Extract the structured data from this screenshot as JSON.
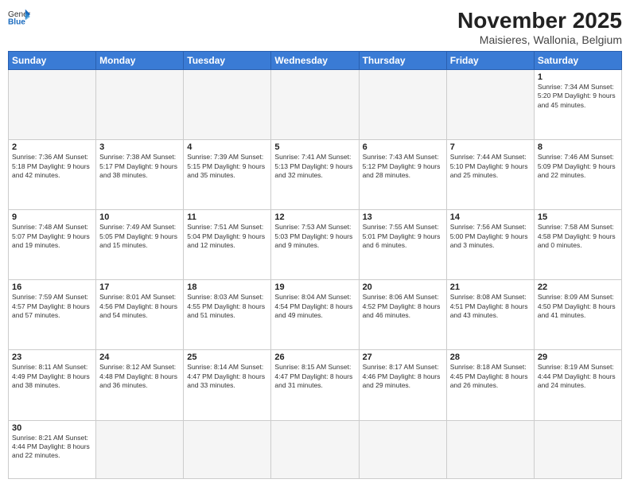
{
  "header": {
    "logo_general": "General",
    "logo_blue": "Blue",
    "month": "November 2025",
    "location": "Maisieres, Wallonia, Belgium"
  },
  "weekdays": [
    "Sunday",
    "Monday",
    "Tuesday",
    "Wednesday",
    "Thursday",
    "Friday",
    "Saturday"
  ],
  "weeks": [
    [
      {
        "day": "",
        "info": ""
      },
      {
        "day": "",
        "info": ""
      },
      {
        "day": "",
        "info": ""
      },
      {
        "day": "",
        "info": ""
      },
      {
        "day": "",
        "info": ""
      },
      {
        "day": "",
        "info": ""
      },
      {
        "day": "1",
        "info": "Sunrise: 7:34 AM\nSunset: 5:20 PM\nDaylight: 9 hours and 45 minutes."
      }
    ],
    [
      {
        "day": "2",
        "info": "Sunrise: 7:36 AM\nSunset: 5:18 PM\nDaylight: 9 hours and 42 minutes."
      },
      {
        "day": "3",
        "info": "Sunrise: 7:38 AM\nSunset: 5:17 PM\nDaylight: 9 hours and 38 minutes."
      },
      {
        "day": "4",
        "info": "Sunrise: 7:39 AM\nSunset: 5:15 PM\nDaylight: 9 hours and 35 minutes."
      },
      {
        "day": "5",
        "info": "Sunrise: 7:41 AM\nSunset: 5:13 PM\nDaylight: 9 hours and 32 minutes."
      },
      {
        "day": "6",
        "info": "Sunrise: 7:43 AM\nSunset: 5:12 PM\nDaylight: 9 hours and 28 minutes."
      },
      {
        "day": "7",
        "info": "Sunrise: 7:44 AM\nSunset: 5:10 PM\nDaylight: 9 hours and 25 minutes."
      },
      {
        "day": "8",
        "info": "Sunrise: 7:46 AM\nSunset: 5:09 PM\nDaylight: 9 hours and 22 minutes."
      }
    ],
    [
      {
        "day": "9",
        "info": "Sunrise: 7:48 AM\nSunset: 5:07 PM\nDaylight: 9 hours and 19 minutes."
      },
      {
        "day": "10",
        "info": "Sunrise: 7:49 AM\nSunset: 5:05 PM\nDaylight: 9 hours and 15 minutes."
      },
      {
        "day": "11",
        "info": "Sunrise: 7:51 AM\nSunset: 5:04 PM\nDaylight: 9 hours and 12 minutes."
      },
      {
        "day": "12",
        "info": "Sunrise: 7:53 AM\nSunset: 5:03 PM\nDaylight: 9 hours and 9 minutes."
      },
      {
        "day": "13",
        "info": "Sunrise: 7:55 AM\nSunset: 5:01 PM\nDaylight: 9 hours and 6 minutes."
      },
      {
        "day": "14",
        "info": "Sunrise: 7:56 AM\nSunset: 5:00 PM\nDaylight: 9 hours and 3 minutes."
      },
      {
        "day": "15",
        "info": "Sunrise: 7:58 AM\nSunset: 4:58 PM\nDaylight: 9 hours and 0 minutes."
      }
    ],
    [
      {
        "day": "16",
        "info": "Sunrise: 7:59 AM\nSunset: 4:57 PM\nDaylight: 8 hours and 57 minutes."
      },
      {
        "day": "17",
        "info": "Sunrise: 8:01 AM\nSunset: 4:56 PM\nDaylight: 8 hours and 54 minutes."
      },
      {
        "day": "18",
        "info": "Sunrise: 8:03 AM\nSunset: 4:55 PM\nDaylight: 8 hours and 51 minutes."
      },
      {
        "day": "19",
        "info": "Sunrise: 8:04 AM\nSunset: 4:54 PM\nDaylight: 8 hours and 49 minutes."
      },
      {
        "day": "20",
        "info": "Sunrise: 8:06 AM\nSunset: 4:52 PM\nDaylight: 8 hours and 46 minutes."
      },
      {
        "day": "21",
        "info": "Sunrise: 8:08 AM\nSunset: 4:51 PM\nDaylight: 8 hours and 43 minutes."
      },
      {
        "day": "22",
        "info": "Sunrise: 8:09 AM\nSunset: 4:50 PM\nDaylight: 8 hours and 41 minutes."
      }
    ],
    [
      {
        "day": "23",
        "info": "Sunrise: 8:11 AM\nSunset: 4:49 PM\nDaylight: 8 hours and 38 minutes."
      },
      {
        "day": "24",
        "info": "Sunrise: 8:12 AM\nSunset: 4:48 PM\nDaylight: 8 hours and 36 minutes."
      },
      {
        "day": "25",
        "info": "Sunrise: 8:14 AM\nSunset: 4:47 PM\nDaylight: 8 hours and 33 minutes."
      },
      {
        "day": "26",
        "info": "Sunrise: 8:15 AM\nSunset: 4:47 PM\nDaylight: 8 hours and 31 minutes."
      },
      {
        "day": "27",
        "info": "Sunrise: 8:17 AM\nSunset: 4:46 PM\nDaylight: 8 hours and 29 minutes."
      },
      {
        "day": "28",
        "info": "Sunrise: 8:18 AM\nSunset: 4:45 PM\nDaylight: 8 hours and 26 minutes."
      },
      {
        "day": "29",
        "info": "Sunrise: 8:19 AM\nSunset: 4:44 PM\nDaylight: 8 hours and 24 minutes."
      }
    ],
    [
      {
        "day": "30",
        "info": "Sunrise: 8:21 AM\nSunset: 4:44 PM\nDaylight: 8 hours and 22 minutes."
      },
      {
        "day": "",
        "info": ""
      },
      {
        "day": "",
        "info": ""
      },
      {
        "day": "",
        "info": ""
      },
      {
        "day": "",
        "info": ""
      },
      {
        "day": "",
        "info": ""
      },
      {
        "day": "",
        "info": ""
      }
    ]
  ]
}
